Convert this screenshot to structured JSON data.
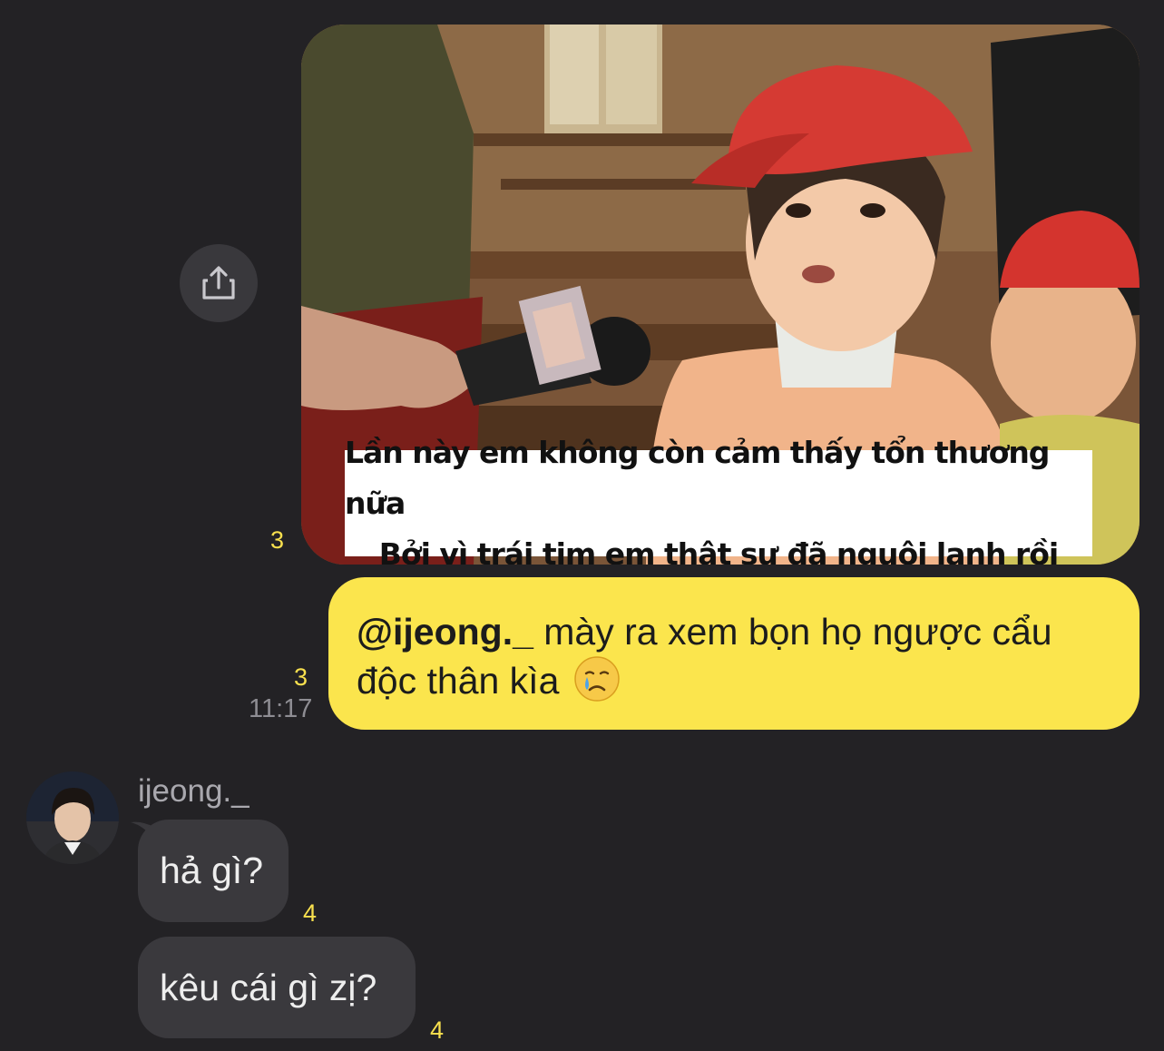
{
  "outgoing": {
    "share_icon": "share-icon",
    "image_message": {
      "caption_line1": "Lần này em không còn cảm thấy tổn thương nữa",
      "caption_line2": "Bởi vì trái tim em thật sự đã nguội lạnh rồi",
      "unread_count": "3"
    },
    "text_message": {
      "mention": "@ijeong._",
      "text": " mày ra xem bọn họ ngược cẩu độc thân kìa",
      "emoji": "crying-face-emoji",
      "unread_count": "3",
      "time": "11:17"
    }
  },
  "incoming": {
    "sender_name": "ijeong._",
    "messages": [
      {
        "text": "hả gì?",
        "unread_count": "4"
      },
      {
        "text": "kêu cái gì zị?",
        "unread_count": "4"
      }
    ]
  },
  "colors": {
    "background": "#232225",
    "outgoing_bubble": "#fbe54d",
    "incoming_bubble": "#3a393d",
    "unread_count": "#f8e04e",
    "timestamp": "#8e8d93"
  }
}
